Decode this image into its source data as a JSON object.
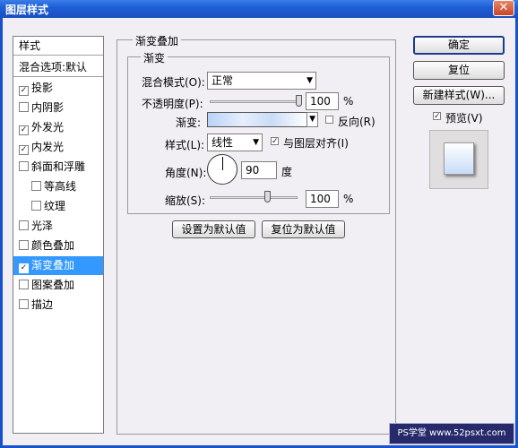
{
  "window": {
    "title": "图层样式",
    "close_glyph": "✕"
  },
  "sidebar": {
    "styles_label": "样式",
    "blend_options_label": "混合选项:默认",
    "items": [
      {
        "label": "投影",
        "checked": true
      },
      {
        "label": "内阴影",
        "checked": false
      },
      {
        "label": "外发光",
        "checked": true
      },
      {
        "label": "内发光",
        "checked": true
      },
      {
        "label": "斜面和浮雕",
        "checked": false
      },
      {
        "label": "等高线",
        "checked": false
      },
      {
        "label": "纹理",
        "checked": false
      },
      {
        "label": "光泽",
        "checked": false
      },
      {
        "label": "颜色叠加",
        "checked": false
      },
      {
        "label": "渐变叠加",
        "checked": true,
        "selected": true
      },
      {
        "label": "图案叠加",
        "checked": false
      },
      {
        "label": "描边",
        "checked": false
      }
    ]
  },
  "panel": {
    "group_title": "渐变叠加",
    "subgroup_title": "渐变",
    "blend_mode_label": "混合模式(O):",
    "blend_mode_value": "正常",
    "opacity_label": "不透明度(P):",
    "opacity_value": "100",
    "opacity_unit": "%",
    "opacity_level": 1.0,
    "gradient_label": "渐变:",
    "reverse_label": "反向(R)",
    "reverse_checked": false,
    "style_label": "样式(L):",
    "style_value": "线性",
    "align_label": "与图层对齐(I)",
    "align_checked": true,
    "angle_label": "角度(N):",
    "angle_value": "90",
    "angle_unit": "度",
    "scale_label": "缩放(S):",
    "scale_value": "100",
    "scale_unit": "%",
    "scale_level": 0.67,
    "set_default_button": "设置为默认值",
    "reset_default_button": "复位为默认值"
  },
  "right": {
    "ok_button": "确定",
    "reset_button": "复位",
    "new_style_button": "新建样式(W)...",
    "preview_label": "预览(V)",
    "preview_checked": true
  },
  "watermark": {
    "text": "PS学堂 www.52psxt.com"
  },
  "colors": {
    "titlebar": "#1f5fd6",
    "selection": "#3399ff",
    "dialog_bg": "#f1eef4"
  },
  "icons": {
    "check": "✓",
    "dropdown": "▼"
  }
}
